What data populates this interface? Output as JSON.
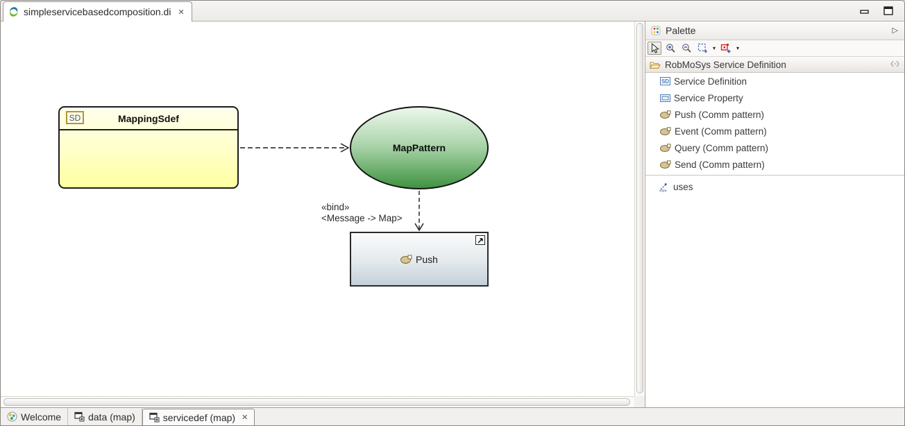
{
  "editor_tab": {
    "title": "simpleservicebasedcomposition.di",
    "close_glyph": "✕"
  },
  "window_icons": [
    "papyrus-icon",
    "minimize-icon",
    "maximize-icon"
  ],
  "palette": {
    "title": "Palette",
    "flyout_glyph": "▷",
    "tools": [
      "select-tool",
      "zoom-in-tool",
      "zoom-out-tool",
      "marquee-tool",
      "note-tool"
    ],
    "drawer_title": "RobMoSys Service Definition",
    "items": [
      {
        "label": "Service Definition",
        "icon": "service-definition-icon"
      },
      {
        "label": "Service Property",
        "icon": "service-property-icon"
      },
      {
        "label": "Push (Comm pattern)",
        "icon": "comm-pattern-icon"
      },
      {
        "label": "Event (Comm pattern)",
        "icon": "comm-pattern-icon"
      },
      {
        "label": "Query (Comm pattern)",
        "icon": "comm-pattern-icon"
      },
      {
        "label": "Send (Comm pattern)",
        "icon": "comm-pattern-icon"
      }
    ],
    "uses_label": "uses"
  },
  "diagram": {
    "mapping_sdef": {
      "badge": "SD",
      "title": "MappingSdef"
    },
    "map_pattern": {
      "title": "MapPattern"
    },
    "push_node": {
      "label": "Push"
    },
    "bind_label": {
      "line1": "«bind»",
      "line2": "<Message -> Map>"
    }
  },
  "bottom_tabs": [
    {
      "label": "Welcome"
    },
    {
      "label": "data (map)"
    },
    {
      "label": "servicedef (map)",
      "close_glyph": "✕"
    }
  ],
  "colors": {
    "node_yellow_top": "#FFFFEC",
    "node_yellow_bottom": "#FFFFA0",
    "node_green_top": "#EDF7ED",
    "node_green_bottom": "#3F9340",
    "node_gray_top": "#FBFCFC",
    "node_gray_bottom": "#C3D0DA",
    "comm_icon_fill": "#D8C493",
    "palette_accent_blue": "#4A7AB5",
    "sd_badge_border": "#B2962E"
  }
}
